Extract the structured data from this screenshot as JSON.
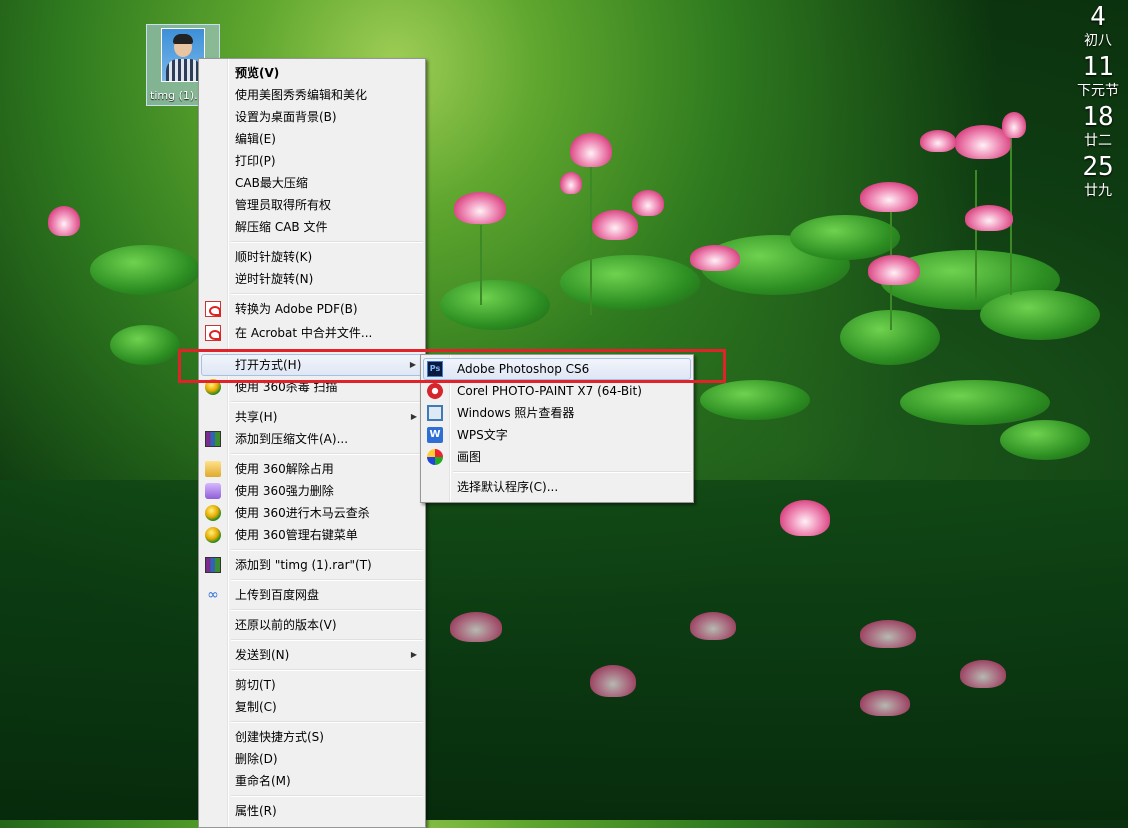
{
  "desktop_icon": {
    "label": "timg (1)."
  },
  "calendar": [
    {
      "day": "4",
      "lunar": "初八"
    },
    {
      "day": "11",
      "lunar": "下元节"
    },
    {
      "day": "18",
      "lunar": "廿二"
    },
    {
      "day": "25",
      "lunar": "廿九"
    }
  ],
  "context_menu": {
    "items": [
      {
        "label": "预览(V)"
      },
      {
        "label": "使用美图秀秀编辑和美化"
      },
      {
        "label": "设置为桌面背景(B)"
      },
      {
        "label": "编辑(E)"
      },
      {
        "label": "打印(P)"
      },
      {
        "label": "CAB最大压缩"
      },
      {
        "label": "管理员取得所有权"
      },
      {
        "label": "解压缩 CAB 文件"
      },
      {
        "label": "顺时针旋转(K)"
      },
      {
        "label": "逆时针旋转(N)"
      },
      {
        "label": "转换为 Adobe PDF(B)",
        "icon": "pdf-icon"
      },
      {
        "label": "在 Acrobat 中合并文件...",
        "icon": "pdf-icon"
      },
      {
        "label": "打开方式(H)"
      },
      {
        "label": "使用 360杀毒 扫描",
        "icon": "360-antivirus-icon"
      },
      {
        "label": "共享(H)"
      },
      {
        "label": "添加到压缩文件(A)...",
        "icon": "winrar-icon"
      },
      {
        "label": "使用 360解除占用",
        "icon": "360-unlock-icon"
      },
      {
        "label": "使用 360强力删除",
        "icon": "360-shred-icon"
      },
      {
        "label": "使用 360进行木马云查杀",
        "icon": "360-trojan-icon"
      },
      {
        "label": "使用 360管理右键菜单",
        "icon": "360-menu-icon"
      },
      {
        "label": "添加到 \"timg (1).rar\"(T)",
        "icon": "winrar-icon"
      },
      {
        "label": "上传到百度网盘",
        "icon": "baidu-cloud-icon"
      },
      {
        "label": "还原以前的版本(V)"
      },
      {
        "label": "发送到(N)"
      },
      {
        "label": "剪切(T)"
      },
      {
        "label": "复制(C)"
      },
      {
        "label": "创建快捷方式(S)"
      },
      {
        "label": "删除(D)"
      },
      {
        "label": "重命名(M)"
      },
      {
        "label": "属性(R)"
      }
    ]
  },
  "open_with_submenu": {
    "items": [
      {
        "label": "Adobe Photoshop CS6",
        "icon": "photoshop-icon",
        "icon_text": "Ps"
      },
      {
        "label": "Corel PHOTO-PAINT X7 (64-Bit)",
        "icon": "corel-icon"
      },
      {
        "label": "Windows 照片查看器",
        "icon": "photo-viewer-icon"
      },
      {
        "label": "WPS文字",
        "icon": "wps-icon",
        "icon_text": "W"
      },
      {
        "label": "画图",
        "icon": "paint-icon"
      },
      {
        "label": "选择默认程序(C)..."
      }
    ]
  },
  "colors": {
    "highlight_box": "#e0232b",
    "menu_bg": "#f0f0f0"
  }
}
